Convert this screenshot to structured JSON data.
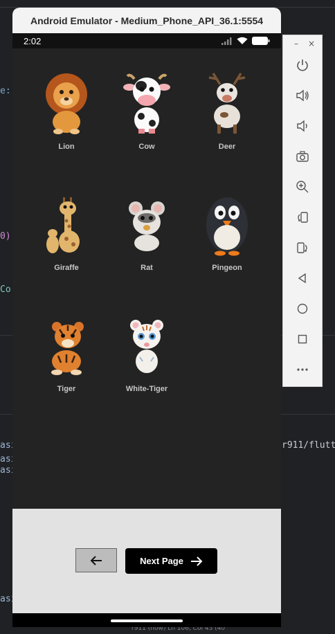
{
  "window": {
    "title": "Android Emulator - Medium_Phone_API_36.1:5554"
  },
  "statusbar": {
    "time": "2:02"
  },
  "animals": [
    {
      "name": "Lion"
    },
    {
      "name": "Cow"
    },
    {
      "name": "Deer"
    },
    {
      "name": "Giraffe"
    },
    {
      "name": "Rat"
    },
    {
      "name": "Pingeon"
    },
    {
      "name": "Tiger"
    },
    {
      "name": "White-Tiger"
    }
  ],
  "navigation": {
    "next_label": "Next Page"
  },
  "toolbar": {
    "controls": {
      "minimize": "–",
      "close": "×"
    },
    "buttons": [
      "power-icon",
      "volume-up-icon",
      "volume-down-icon",
      "camera-icon",
      "zoom-icon",
      "rotate-left-icon",
      "rotate-right-icon",
      "back-icon",
      "home-icon",
      "overview-icon",
      "more-icon"
    ]
  },
  "background_code": {
    "fragments": [
      "e:",
      "0)",
      "Co",
      "asi",
      "asi",
      "asi",
      "r911/flutt",
      "asi"
    ],
    "footer": "r911 (now)   Ln 106, Col 43 (40"
  },
  "colors": {
    "app_bg": "#232323",
    "panel_bg": "#e2e2e2",
    "next_btn": "#000000",
    "back_btn": "#bcbcbc"
  }
}
